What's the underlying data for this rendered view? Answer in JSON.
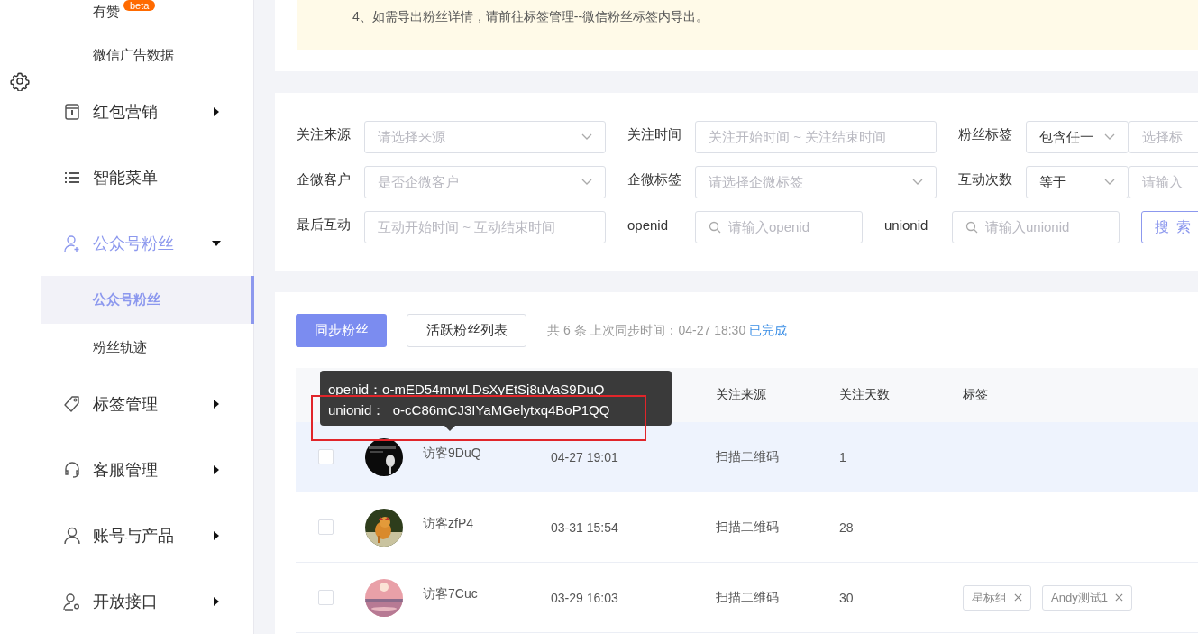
{
  "sidebar": {
    "items": [
      {
        "kind": "sub",
        "label": "有赞",
        "badge": "beta",
        "selected": false
      },
      {
        "kind": "sub",
        "label": "微信广告数据",
        "selected": false
      },
      {
        "kind": "main",
        "label": "红包营销",
        "expanded": false
      },
      {
        "kind": "main",
        "label": "智能菜单"
      },
      {
        "kind": "main",
        "label": "公众号粉丝",
        "expanded": true
      },
      {
        "kind": "sub",
        "label": "公众号粉丝",
        "selected": true
      },
      {
        "kind": "sub",
        "label": "粉丝轨迹",
        "selected": false
      },
      {
        "kind": "main",
        "label": "标签管理",
        "expanded": false
      },
      {
        "kind": "main",
        "label": "客服管理",
        "expanded": false
      },
      {
        "kind": "main",
        "label": "账号与产品",
        "expanded": false
      },
      {
        "kind": "main",
        "label": "开放接口",
        "expanded": false
      }
    ]
  },
  "notice": {
    "lines": [
      "4、如需导出粉丝详情，请前往标签管理--微信粉丝标签内导出。"
    ]
  },
  "filters": {
    "rows": [
      [
        {
          "label": "关注来源",
          "controls": [
            {
              "kind": "select",
              "placeholder": "请选择来源"
            }
          ]
        },
        {
          "label": "关注时间",
          "controls": [
            {
              "kind": "range",
              "placeholder": "关注开始时间 ~ 关注结束时间"
            }
          ]
        },
        {
          "label": "粉丝标签",
          "controls": [
            {
              "kind": "operator",
              "value": "包含任一"
            },
            {
              "kind": "input",
              "placeholder": "选择标"
            }
          ]
        }
      ],
      [
        {
          "label": "企微客户",
          "controls": [
            {
              "kind": "select",
              "placeholder": "是否企微客户"
            }
          ]
        },
        {
          "label": "企微标签",
          "controls": [
            {
              "kind": "select",
              "placeholder": "请选择企微标签"
            }
          ]
        },
        {
          "label": "互动次数",
          "controls": [
            {
              "kind": "operator",
              "value": "等于"
            },
            {
              "kind": "input",
              "placeholder": "请输入"
            }
          ]
        }
      ],
      [
        {
          "label": "最后互动",
          "controls": [
            {
              "kind": "range",
              "placeholder": "互动开始时间 ~ 互动结束时间"
            }
          ]
        },
        {
          "label": "openid",
          "controls": [
            {
              "kind": "search",
              "placeholder": "请输入openid"
            }
          ]
        },
        {
          "label": "unionid",
          "controls": [
            {
              "kind": "search",
              "placeholder": "请输入unionid"
            }
          ]
        }
      ]
    ],
    "search_button": "搜 索"
  },
  "toolbar": {
    "sync_button": "同步粉丝",
    "active_list_button": "活跃粉丝列表",
    "sync_info": "共 6 条 上次同步时间：04-27 18:30",
    "sync_status": "已完成"
  },
  "table": {
    "columns": [
      "关注来源",
      "关注天数",
      "标签"
    ],
    "rows": [
      {
        "checked": false,
        "highlighted": true,
        "avatar": {
          "kind": "picture"
        },
        "name": "访客9DuQ",
        "followed_at": "04-27 19:01",
        "source": "扫描二维码",
        "days": "1",
        "tags": []
      },
      {
        "checked": false,
        "highlighted": false,
        "avatar": {
          "kind": "picture"
        },
        "name": "访客zfP4",
        "followed_at": "03-31 15:54",
        "source": "扫描二维码",
        "days": "28",
        "tags": []
      },
      {
        "checked": false,
        "highlighted": false,
        "avatar": {
          "kind": "picture"
        },
        "name": "访客7Cuc",
        "followed_at": "03-29 16:03",
        "source": "扫描二维码",
        "days": "30",
        "tags": [
          {
            "label": "星标组"
          },
          {
            "label": "Andy测试1"
          }
        ]
      }
    ]
  },
  "tooltip": {
    "lines": [
      "openid：o-mED54mrwLDsXyEtSj8uVaS9DuQ",
      "unionid：  o-cC86mCJ3IYaMGelytxq4BoP1QQ"
    ]
  },
  "annotation": {
    "kind": "highlight-frame"
  }
}
